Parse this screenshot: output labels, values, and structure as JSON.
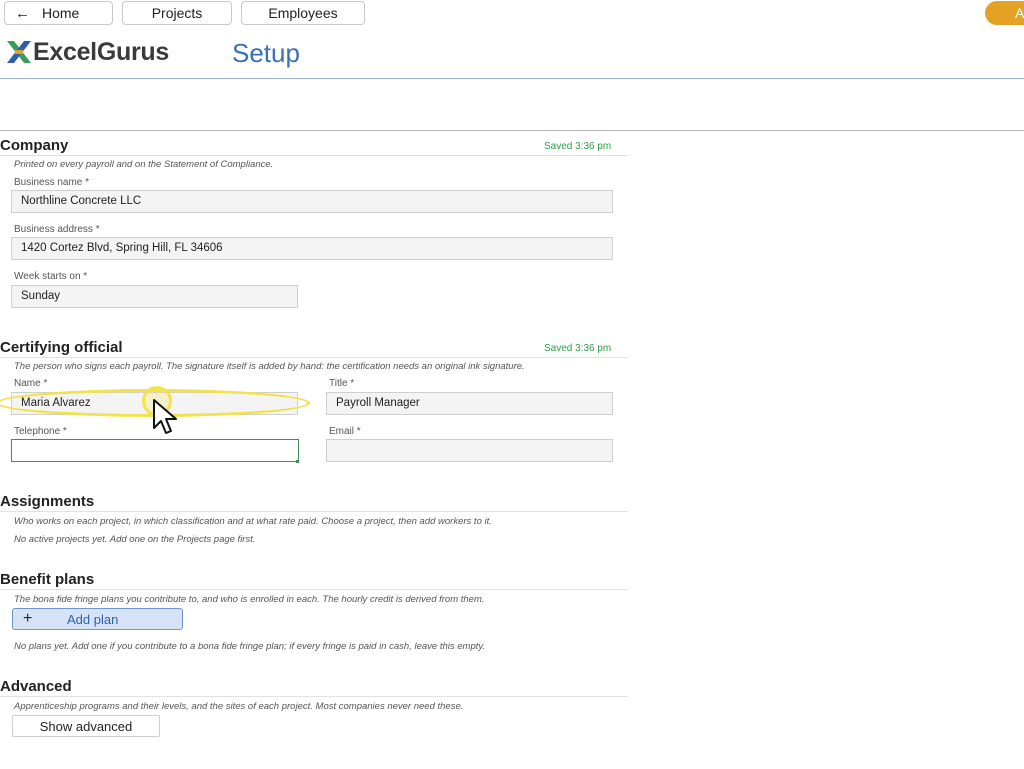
{
  "nav": {
    "home": "Home",
    "projects": "Projects",
    "employees": "Employees",
    "pill": "A"
  },
  "header": {
    "logo_text": "ExcelGurus",
    "title": "Setup"
  },
  "company": {
    "title": "Company",
    "saved": "Saved 3:36 pm",
    "description": "Printed on every payroll and on the Statement of Compliance.",
    "business_name_label": "Business name *",
    "business_name": "Northline Concrete LLC",
    "business_address_label": "Business address *",
    "business_address": "1420 Cortez Blvd, Spring Hill, FL 34606",
    "week_starts_label": "Week starts on *",
    "week_starts": "Sunday"
  },
  "official": {
    "title": "Certifying official",
    "saved": "Saved 3:36 pm",
    "description": "The person who signs each payroll. The signature itself is added by hand: the certification needs an original ink signature.",
    "name_label": "Name *",
    "name": "Maria Alvarez",
    "title_label": "Title *",
    "title_value": "Payroll Manager",
    "telephone_label": "Telephone *",
    "telephone": "",
    "email_label": "Email *",
    "email": ""
  },
  "assignments": {
    "title": "Assignments",
    "description": "Who works on each project, in which classification and at what rate paid. Choose a project, then add workers to it.",
    "empty": "No active projects yet. Add one on the Projects page first."
  },
  "benefits": {
    "title": "Benefit plans",
    "description": "The bona fide fringe plans you contribute to, and who is enrolled in each. The hourly credit is derived from them.",
    "add_plus": "+",
    "add_label": "Add plan",
    "empty": "No plans yet. Add one if you contribute to a bona fide fringe plan; if every fringe is paid in cash, leave this empty."
  },
  "advanced": {
    "title": "Advanced",
    "description": "Apprenticeship programs and their levels, and the sites of each project. Most companies never need these.",
    "button": "Show advanced"
  },
  "colors": {
    "accent": "#3b6fb6",
    "saved": "#2e9e48",
    "pill": "#e3a224",
    "highlight": "#f2e34c"
  }
}
